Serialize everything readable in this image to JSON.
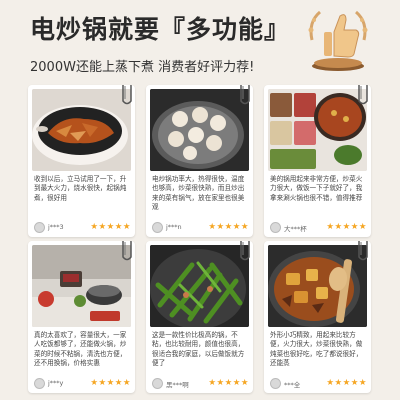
{
  "header": {
    "title": "电炒锅就要『多功能』",
    "subtitle": "2000W还能上蒸下煮 消费者好评力荐!"
  },
  "reviews": [
    {
      "text": "收到以后，立马试用了一下，升到最大火力，烧水很快，起锅炖煮，很好用",
      "user": "j***3",
      "stars": "★★★★★"
    },
    {
      "text": "电炒锅功率大，热得很快，温度也够高，炒菜很快熟，而且炒出来的菜有锅气，放在家里也很美观",
      "user": "j***n",
      "stars": "★★★★★"
    },
    {
      "text": "美的锅用起来非常方便，炒菜火力很大，做饭一下子就好了，我拿来涮火锅也很不错，值得推荐",
      "user": "大***杯",
      "stars": "★★★★★"
    },
    {
      "text": "真的太喜欢了，容量很大，一家人吃饭都够了，还能做火锅，炒菜的时候不粘锅，清洗也方便，还不用换锅，价格实惠",
      "user": "j***y",
      "stars": "★★★★★"
    },
    {
      "text": "这是一款性价比极高的锅，不粘，也比较耐用，颜值也很高，很适合我的家庭，以后做饭就方便了",
      "user": "黑***啊",
      "stars": "★★★★★"
    },
    {
      "text": "外形小巧精致，用起来比较方便，火力很大，炒菜很快熟，做炖菜也很好吃，吃了都说很好，还能蒸",
      "user": "***全",
      "stars": "★★★★★"
    }
  ],
  "colors": {
    "stars": "#f5a623",
    "gold": "#c9935a"
  },
  "icons": [
    "thumbs-up-icon",
    "binder-clip-icon",
    "avatar-icon",
    "star-icon"
  ]
}
